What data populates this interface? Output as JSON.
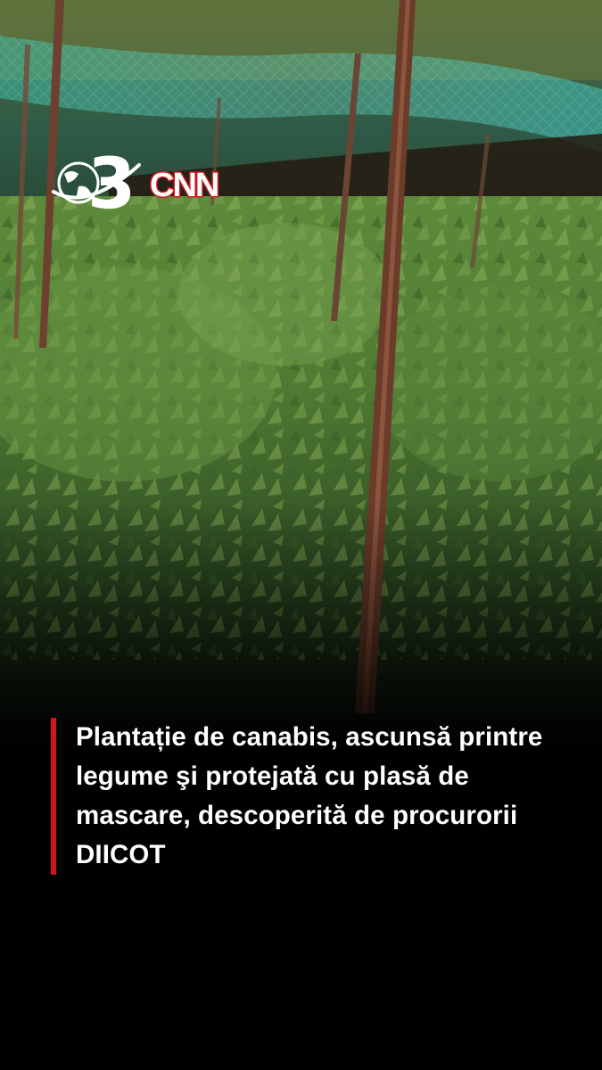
{
  "video": {
    "scene_description_icon": "cannabis-plantation-photo"
  },
  "logo": {
    "channel_number": "3",
    "brand": "CNN",
    "brand_color": "#d0161b"
  },
  "caption": {
    "text": "Plantație de canabis, ascunsă printre legume şi protejată cu plasă de mascare, descoperită de procurorii DIICOT",
    "accent_color": "#d0161b"
  }
}
